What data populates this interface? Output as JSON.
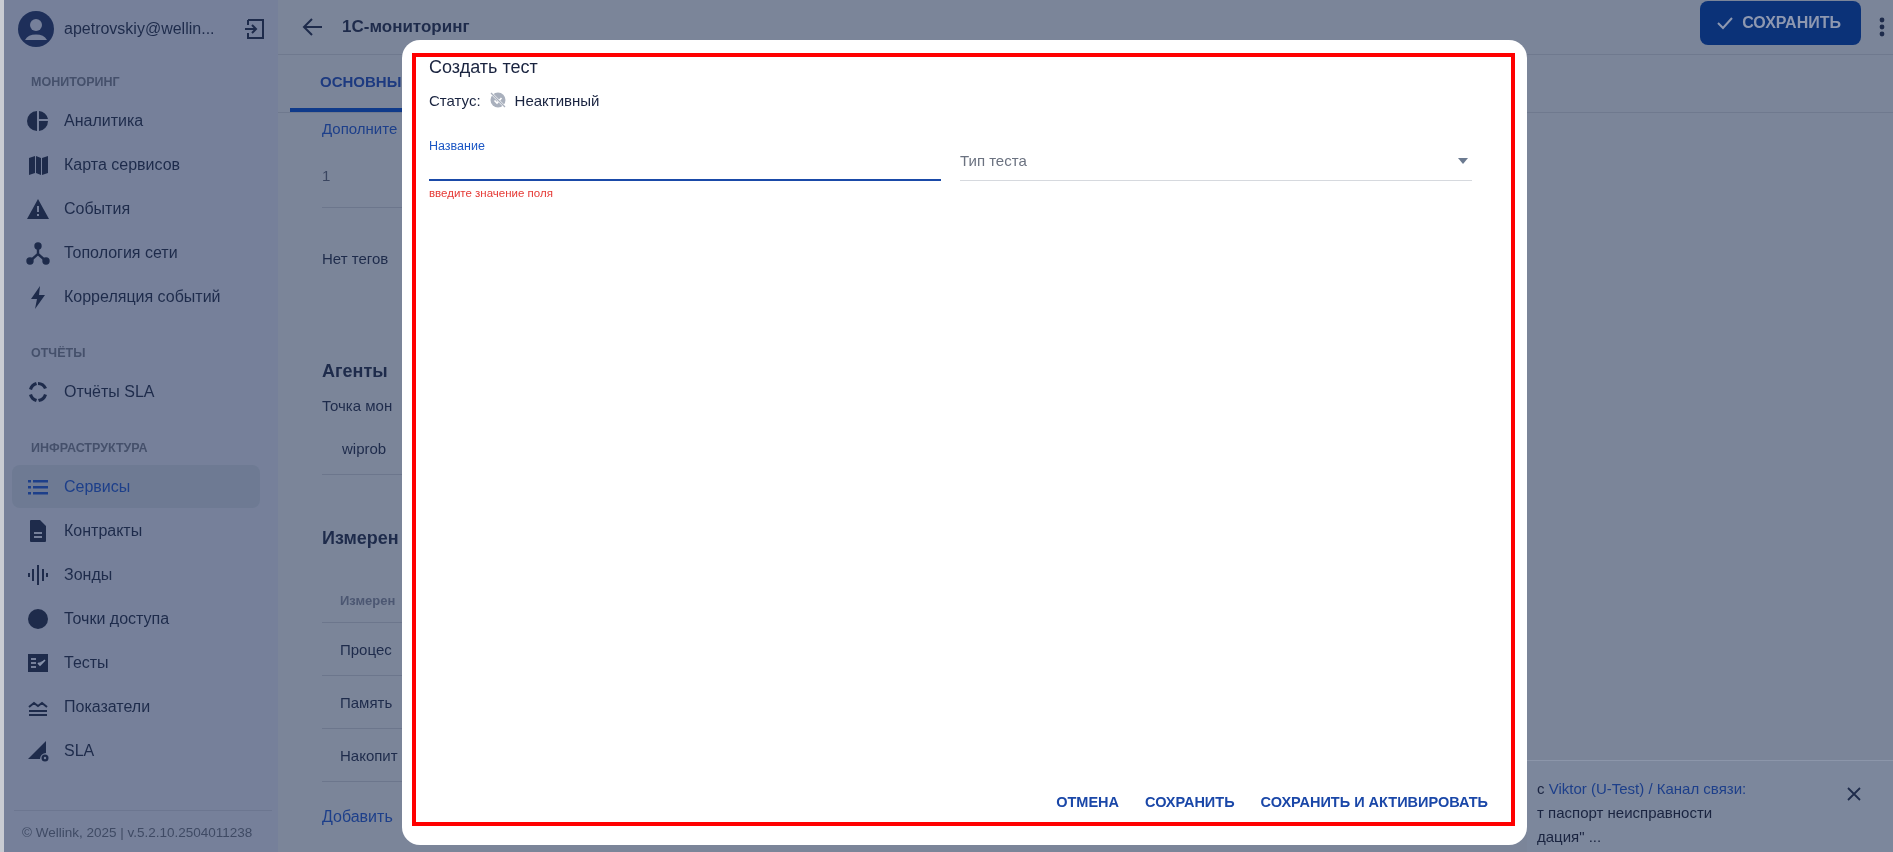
{
  "sidebar": {
    "user": "apetrovskiy@wellin...",
    "sections": [
      {
        "title": "МОНИТОРИНГ",
        "items": [
          {
            "label": "Аналитика",
            "selected": false
          },
          {
            "label": "Карта сервисов",
            "selected": false
          },
          {
            "label": "События",
            "selected": false
          },
          {
            "label": "Топология сети",
            "selected": false
          },
          {
            "label": "Корреляция событий",
            "selected": false
          }
        ]
      },
      {
        "title": "ОТЧЁТЫ",
        "items": [
          {
            "label": "Отчёты SLA",
            "selected": false
          }
        ]
      },
      {
        "title": "ИНФРАСТРУКТУРА",
        "items": [
          {
            "label": "Сервисы",
            "selected": true
          },
          {
            "label": "Контракты",
            "selected": false
          },
          {
            "label": "Зонды",
            "selected": false
          },
          {
            "label": "Точки доступа",
            "selected": false
          },
          {
            "label": "Тесты",
            "selected": false
          },
          {
            "label": "Показатели",
            "selected": false
          },
          {
            "label": "SLA",
            "selected": false
          }
        ]
      }
    ],
    "footer": "© Wellink, 2025 | v.5.2.10.2504011238"
  },
  "header": {
    "title": "1С-мониторинг",
    "save_button": "СОХРАНИТЬ"
  },
  "tabs": [
    {
      "label": "ОСНОВНЫ",
      "selected": true
    }
  ],
  "content": [
    {
      "kind": "link",
      "text": "Дополните"
    },
    {
      "kind": "value",
      "text": "1"
    },
    {
      "kind": "note",
      "text": "Нет тегов"
    },
    {
      "kind": "heading",
      "text": "Агенты"
    },
    {
      "kind": "label",
      "text": "Точка мон"
    },
    {
      "kind": "agent",
      "text": "wiprob"
    },
    {
      "kind": "heading",
      "text": "Измерен"
    },
    {
      "kind": "column_header",
      "text": "Измерен"
    },
    {
      "kind": "row",
      "text": "Процес"
    },
    {
      "kind": "row",
      "text": "Память"
    },
    {
      "kind": "row",
      "text": "Накопит"
    },
    {
      "kind": "action",
      "text": "Добавить"
    }
  ],
  "dialog": {
    "title": "Создать тест",
    "status": {
      "label": "Статус:",
      "value": "Неактивный",
      "active": false
    },
    "fields": [
      {
        "kind": "text",
        "label": "Название",
        "focused": true,
        "error": "введите значение поля"
      },
      {
        "kind": "select",
        "placeholder": "Тип теста",
        "focused": false
      }
    ],
    "buttons": [
      "ОТМЕНА",
      "СОХРАНИТЬ",
      "СОХРАНИТЬ И АКТИВИРОВАТЬ"
    ]
  },
  "notification": {
    "lines": [
      {
        "prefix": "с ",
        "link": "Viktor (U-Test) / Канал связи:"
      },
      {
        "prefix": "т паспорт неисправности"
      },
      {
        "prefix": "дация\" ..."
      }
    ]
  }
}
